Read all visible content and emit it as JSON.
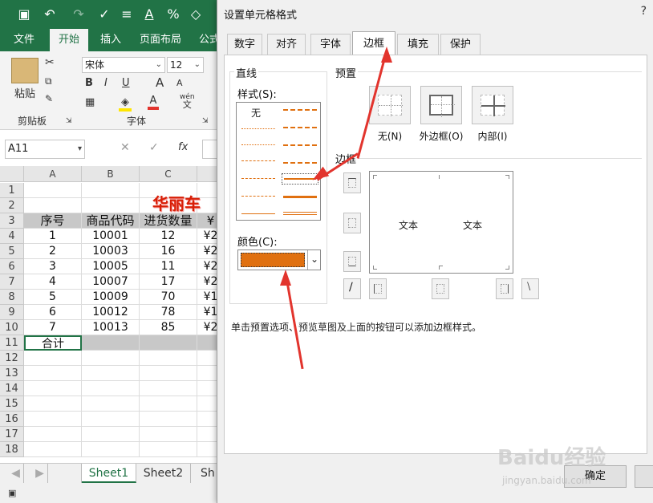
{
  "qat": {
    "icons": [
      "save-icon",
      "undo-icon",
      "redo-icon",
      "spelling-icon",
      "align-icon",
      "font-color-icon",
      "percent-icon",
      "format-icon"
    ],
    "percent_glyph": "%"
  },
  "ribbon_tabs": [
    "文件",
    "开始",
    "插入",
    "页面布局",
    "公式"
  ],
  "ribbon": {
    "paste_label": "粘贴",
    "clipboard_group": "剪贴板",
    "font_name": "宋体",
    "font_size": "12",
    "font_group": "字体",
    "bold": "B",
    "italic": "I",
    "underline": "U",
    "grow": "A",
    "shrink": "A",
    "font_color_glyph": "A",
    "phonetic_top": "wén",
    "phonetic_bottom": "文"
  },
  "formula_bar": {
    "name_box": "A11",
    "fx": "fx"
  },
  "sheet": {
    "columns": [
      "A",
      "B",
      "C"
    ],
    "rows": [
      "1",
      "2",
      "3",
      "4",
      "5",
      "6",
      "7",
      "8",
      "9",
      "10",
      "11",
      "12",
      "13",
      "14",
      "15",
      "16",
      "17",
      "18"
    ],
    "title_fragment": "华丽车",
    "headers": [
      "序号",
      "商品代码",
      "进货数量",
      "¥"
    ],
    "data": [
      [
        "1",
        "10001",
        "12",
        "¥2"
      ],
      [
        "2",
        "10003",
        "16",
        "¥2"
      ],
      [
        "3",
        "10005",
        "11",
        "¥2"
      ],
      [
        "4",
        "10007",
        "17",
        "¥2"
      ],
      [
        "5",
        "10009",
        "70",
        "¥1"
      ],
      [
        "6",
        "10012",
        "78",
        "¥1"
      ],
      [
        "7",
        "10013",
        "85",
        "¥2"
      ]
    ],
    "total_label": "合计"
  },
  "sheet_tabs": [
    "Sheet1",
    "Sheet2",
    "Sh"
  ],
  "dialog": {
    "title": "设置单元格格式",
    "help": "?",
    "tabs": [
      "数字",
      "对齐",
      "字体",
      "边框",
      "填充",
      "保护"
    ],
    "active_tab": "边框",
    "line_group": "直线",
    "style_label": "样式(S):",
    "none_label": "无",
    "color_label": "颜色(C):",
    "color_value": "#e07010",
    "preset_group": "预置",
    "presets": [
      "无(N)",
      "外边框(O)",
      "内部(I)"
    ],
    "border_group": "边框",
    "preview_text_1": "文本",
    "preview_text_2": "文本",
    "hint": "单击预置选项、预览草图及上面的按钮可以添加边框样式。",
    "ok_label": "确定"
  },
  "watermark": {
    "text": "Baidu经验",
    "url": "jingyan.baidu.com"
  },
  "colors": {
    "excel_green": "#217346",
    "accent_orange": "#e07010",
    "arrow_red": "#e2342d",
    "title_red": "#d81e06"
  }
}
